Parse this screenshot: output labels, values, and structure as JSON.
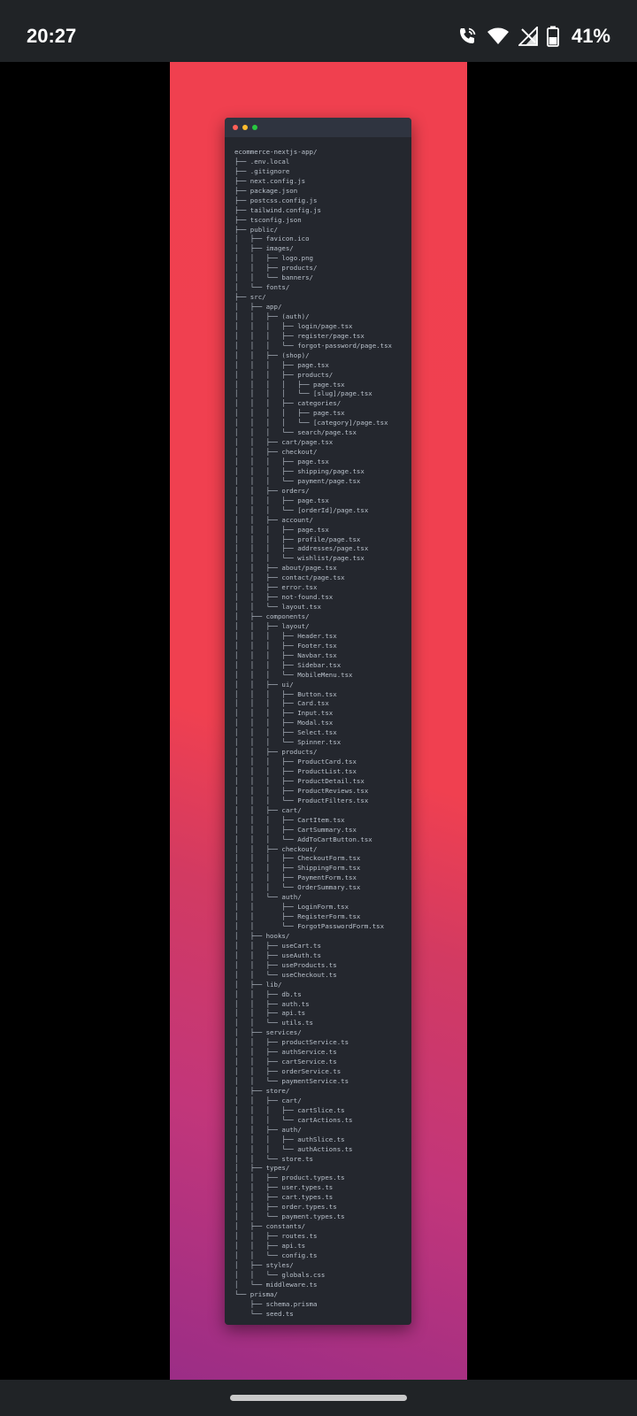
{
  "status_bar": {
    "time": "20:27",
    "battery_percent": "41%",
    "icons": [
      "wifi-calling-icon",
      "wifi-icon",
      "cellular-signal-icon",
      "battery-icon"
    ]
  },
  "code_window": {
    "controls": [
      "close-dot",
      "minimize-dot",
      "maximize-dot"
    ],
    "tree_lines": [
      "ecommerce-nextjs-app/",
      "├── .env.local",
      "├── .gitignore",
      "├── next.config.js",
      "├── package.json",
      "├── postcss.config.js",
      "├── tailwind.config.js",
      "├── tsconfig.json",
      "├── public/",
      "│   ├── favicon.ico",
      "│   ├── images/",
      "│   │   ├── logo.png",
      "│   │   ├── products/",
      "│   │   └── banners/",
      "│   └── fonts/",
      "├── src/",
      "│   ├── app/",
      "│   │   ├── (auth)/",
      "│   │   │   ├── login/page.tsx",
      "│   │   │   ├── register/page.tsx",
      "│   │   │   └── forgot-password/page.tsx",
      "│   │   ├── (shop)/",
      "│   │   │   ├── page.tsx",
      "│   │   │   ├── products/",
      "│   │   │   │   ├── page.tsx",
      "│   │   │   │   └── [slug]/page.tsx",
      "│   │   │   ├── categories/",
      "│   │   │   │   ├── page.tsx",
      "│   │   │   │   └── [category]/page.tsx",
      "│   │   │   └── search/page.tsx",
      "│   │   ├── cart/page.tsx",
      "│   │   ├── checkout/",
      "│   │   │   ├── page.tsx",
      "│   │   │   ├── shipping/page.tsx",
      "│   │   │   └── payment/page.tsx",
      "│   │   ├── orders/",
      "│   │   │   ├── page.tsx",
      "│   │   │   └── [orderId]/page.tsx",
      "│   │   ├── account/",
      "│   │   │   ├── page.tsx",
      "│   │   │   ├── profile/page.tsx",
      "│   │   │   ├── addresses/page.tsx",
      "│   │   │   └── wishlist/page.tsx",
      "│   │   ├── about/page.tsx",
      "│   │   ├── contact/page.tsx",
      "│   │   ├── error.tsx",
      "│   │   ├── not-found.tsx",
      "│   │   └── layout.tsx",
      "│   ├── components/",
      "│   │   ├── layout/",
      "│   │   │   ├── Header.tsx",
      "│   │   │   ├── Footer.tsx",
      "│   │   │   ├── Navbar.tsx",
      "│   │   │   ├── Sidebar.tsx",
      "│   │   │   └── MobileMenu.tsx",
      "│   │   ├── ui/",
      "│   │   │   ├── Button.tsx",
      "│   │   │   ├── Card.tsx",
      "│   │   │   ├── Input.tsx",
      "│   │   │   ├── Modal.tsx",
      "│   │   │   ├── Select.tsx",
      "│   │   │   └── Spinner.tsx",
      "│   │   ├── products/",
      "│   │   │   ├── ProductCard.tsx",
      "│   │   │   ├── ProductList.tsx",
      "│   │   │   ├── ProductDetail.tsx",
      "│   │   │   ├── ProductReviews.tsx",
      "│   │   │   └── ProductFilters.tsx",
      "│   │   ├── cart/",
      "│   │   │   ├── CartItem.tsx",
      "│   │   │   ├── CartSummary.tsx",
      "│   │   │   └── AddToCartButton.tsx",
      "│   │   ├── checkout/",
      "│   │   │   ├── CheckoutForm.tsx",
      "│   │   │   ├── ShippingForm.tsx",
      "│   │   │   ├── PaymentForm.tsx",
      "│   │   │   └── OrderSummary.tsx",
      "│   │   └── auth/",
      "│   │       ├── LoginForm.tsx",
      "│   │       ├── RegisterForm.tsx",
      "│   │       └── ForgotPasswordForm.tsx",
      "│   ├── hooks/",
      "│   │   ├── useCart.ts",
      "│   │   ├── useAuth.ts",
      "│   │   ├── useProducts.ts",
      "│   │   └── useCheckout.ts",
      "│   ├── lib/",
      "│   │   ├── db.ts",
      "│   │   ├── auth.ts",
      "│   │   ├── api.ts",
      "│   │   └── utils.ts",
      "│   ├── services/",
      "│   │   ├── productService.ts",
      "│   │   ├── authService.ts",
      "│   │   ├── cartService.ts",
      "│   │   ├── orderService.ts",
      "│   │   └── paymentService.ts",
      "│   ├── store/",
      "│   │   ├── cart/",
      "│   │   │   ├── cartSlice.ts",
      "│   │   │   └── cartActions.ts",
      "│   │   ├── auth/",
      "│   │   │   ├── authSlice.ts",
      "│   │   │   └── authActions.ts",
      "│   │   └── store.ts",
      "│   ├── types/",
      "│   │   ├── product.types.ts",
      "│   │   ├── user.types.ts",
      "│   │   ├── cart.types.ts",
      "│   │   ├── order.types.ts",
      "│   │   └── payment.types.ts",
      "│   ├── constants/",
      "│   │   ├── routes.ts",
      "│   │   ├── api.ts",
      "│   │   └── config.ts",
      "│   ├── styles/",
      "│   │   └── globals.css",
      "│   └── middleware.ts",
      "└── prisma/",
      "    ├── schema.prisma",
      "    └── seed.ts"
    ]
  },
  "colors": {
    "status_bar_bg": "#202326",
    "gradient_top": "#f0404f",
    "gradient_bottom": "#9b2d86",
    "window_bg": "#24272e",
    "tree_text": "#b9c1cb"
  }
}
